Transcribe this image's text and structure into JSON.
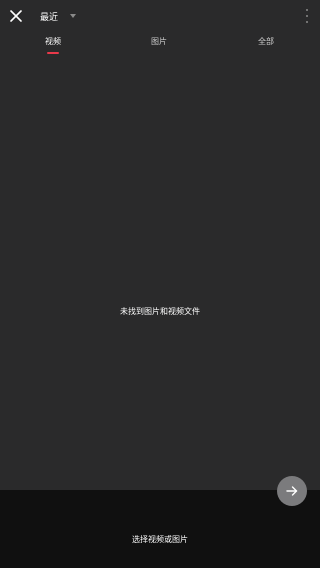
{
  "header": {
    "close_icon": "close-icon",
    "album_label": "最近",
    "dropdown_icon": "caret-down-icon",
    "more_icon": "more-vertical-icon"
  },
  "tabs": [
    {
      "label": "视频",
      "active": true
    },
    {
      "label": "图片",
      "active": false
    },
    {
      "label": "全部",
      "active": false
    }
  ],
  "colors": {
    "background": "#2a2a2b",
    "bottom_panel": "#101010",
    "accent": "#e8394a",
    "fab": "#7b7b7d"
  },
  "empty_state": {
    "message": "未找到图片和视频文件"
  },
  "fab": {
    "icon": "arrow-right-icon"
  },
  "bottom": {
    "hint": "选择视频或图片"
  }
}
